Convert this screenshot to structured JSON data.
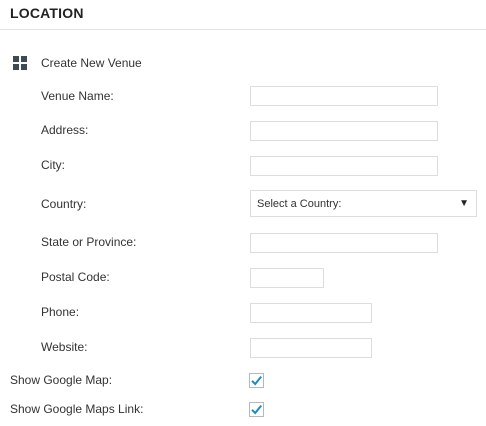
{
  "section": {
    "title": "LOCATION"
  },
  "venue": {
    "header": "Create New Venue",
    "icon": "grid-icon",
    "fields": {
      "name": {
        "label": "Venue Name:",
        "value": ""
      },
      "address": {
        "label": "Address:",
        "value": ""
      },
      "city": {
        "label": "City:",
        "value": ""
      },
      "country": {
        "label": "Country:",
        "selected": "Select a Country:"
      },
      "state": {
        "label": "State or Province:",
        "value": ""
      },
      "postal": {
        "label": "Postal Code:",
        "value": ""
      },
      "phone": {
        "label": "Phone:",
        "value": ""
      },
      "website": {
        "label": "Website:",
        "value": ""
      }
    }
  },
  "options": {
    "show_map": {
      "label": "Show Google Map:",
      "checked": true
    },
    "show_map_link": {
      "label": "Show Google Maps Link:",
      "checked": true
    }
  },
  "colors": {
    "checkmark": "#1e8cbe",
    "icon": "#3d4b57"
  }
}
